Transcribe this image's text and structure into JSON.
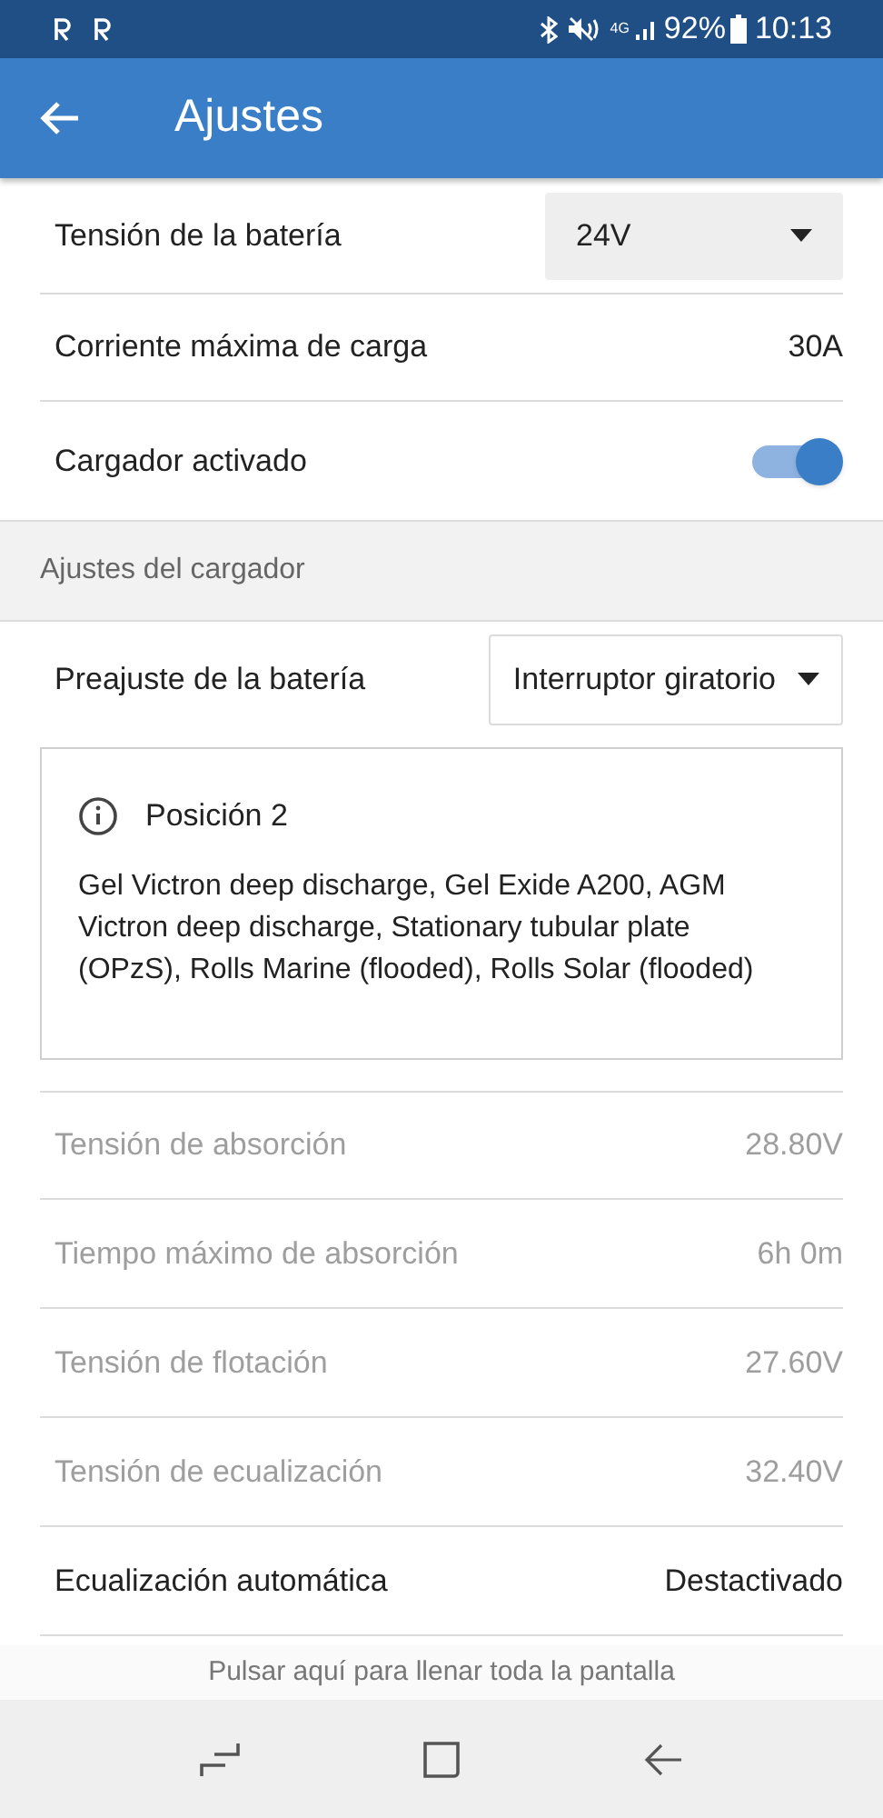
{
  "status_bar": {
    "network": "4G",
    "battery": "92%",
    "time": "10:13"
  },
  "app_bar": {
    "title": "Ajustes"
  },
  "settings": [
    {
      "kind": "dropdown",
      "label": "Tensión de la batería",
      "value": "24V",
      "disabled": false
    },
    {
      "kind": "value",
      "label": "Corriente máxima de carga",
      "value": "30A",
      "disabled": false
    },
    {
      "kind": "toggle",
      "label": "Cargador activado",
      "on": true,
      "disabled": false
    }
  ],
  "charger_section": {
    "header": "Ajustes del cargador",
    "preset": {
      "label": "Preajuste de la batería",
      "value": "Interruptor giratorio"
    },
    "info": {
      "title": "Posición 2",
      "text": "Gel Victron deep discharge, Gel Exide A200, AGM Victron deep discharge, Stationary tubular plate (OPzS), Rolls Marine (flooded), Rolls Solar (flooded)"
    },
    "rows": [
      {
        "kind": "value",
        "label": "Tensión de absorción",
        "value": "28.80V",
        "disabled": true
      },
      {
        "kind": "value",
        "label": "Tiempo máximo de absorción",
        "value": "6h 0m",
        "disabled": true
      },
      {
        "kind": "value",
        "label": "Tensión de flotación",
        "value": "27.60V",
        "disabled": true
      },
      {
        "kind": "value",
        "label": "Tensión de ecualización",
        "value": "32.40V",
        "disabled": true
      },
      {
        "kind": "value",
        "label": "Ecualización automática",
        "value": "Destactivado",
        "disabled": false
      }
    ]
  },
  "fullscreen_banner": "Pulsar aquí para llenar toda la pantalla"
}
